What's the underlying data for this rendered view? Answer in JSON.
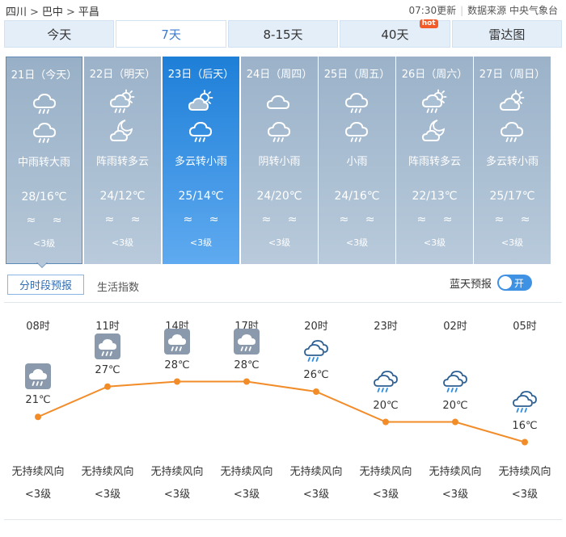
{
  "breadcrumb": {
    "province": "四川",
    "city": "巴中",
    "county": "平昌"
  },
  "meta": {
    "update": "07:30更新",
    "source_label": "数据来源 中央气象台"
  },
  "tabs": [
    {
      "label": "今天"
    },
    {
      "label": "7天"
    },
    {
      "label": "8-15天"
    },
    {
      "label": "40天",
      "badge": "hot"
    },
    {
      "label": "雷达图"
    }
  ],
  "days": [
    {
      "date": "21日（今天）",
      "icon_day": "rain-cloud-icon",
      "icon_night": "rain-cloud-icon",
      "desc": "中雨转大雨",
      "temp": "28/16℃",
      "wind": "≈ ≈",
      "level": "<3级"
    },
    {
      "date": "22日（明天）",
      "icon_day": "sun-shower-icon",
      "icon_night": "moon-cloud-icon",
      "desc": "阵雨转多云",
      "temp": "24/12℃",
      "wind": "≈ ≈",
      "level": "<3级"
    },
    {
      "date": "23日（后天）",
      "icon_day": "partly-cloudy-icon",
      "icon_night": "rain-cloud-icon",
      "desc": "多云转小雨",
      "temp": "25/14℃",
      "wind": "≈ ≈",
      "level": "<3级"
    },
    {
      "date": "24日（周四）",
      "icon_day": "cloud-icon",
      "icon_night": "rain-cloud-icon",
      "desc": "阴转小雨",
      "temp": "24/20℃",
      "wind": "≈ ≈",
      "level": "<3级"
    },
    {
      "date": "25日（周五）",
      "icon_day": "rain-cloud-icon",
      "icon_night": "rain-cloud-icon",
      "desc": "小雨",
      "temp": "24/16℃",
      "wind": "≈ ≈",
      "level": "<3级"
    },
    {
      "date": "26日（周六）",
      "icon_day": "sun-shower-icon",
      "icon_night": "moon-cloud-icon",
      "desc": "阵雨转多云",
      "temp": "22/13℃",
      "wind": "≈ ≈",
      "level": "<3级"
    },
    {
      "date": "27日（周日）",
      "icon_day": "partly-cloudy-icon",
      "icon_night": "rain-cloud-icon",
      "desc": "多云转小雨",
      "temp": "25/17℃",
      "wind": "≈ ≈",
      "level": "<3级"
    }
  ],
  "subtabs": {
    "hourly": "分时段预报",
    "life": "生活指数"
  },
  "bluesky": {
    "label": "蓝天预报",
    "toggle": "开"
  },
  "hourly": [
    {
      "time": "08时",
      "temp": "21℃",
      "icon": "rain-box-icon",
      "wind": "无持续风向",
      "level": "<3级"
    },
    {
      "time": "11时",
      "temp": "27℃",
      "icon": "rain-box-icon",
      "wind": "无持续风向",
      "level": "<3级"
    },
    {
      "time": "14时",
      "temp": "28℃",
      "icon": "rain-box-icon",
      "wind": "无持续风向",
      "level": "<3级"
    },
    {
      "time": "17时",
      "temp": "28℃",
      "icon": "rain-box-icon",
      "wind": "无持续风向",
      "level": "<3级"
    },
    {
      "time": "20时",
      "temp": "26℃",
      "icon": "light-rain-icon",
      "wind": "无持续风向",
      "level": "<3级"
    },
    {
      "time": "23时",
      "temp": "20℃",
      "icon": "light-rain-icon",
      "wind": "无持续风向",
      "level": "<3级"
    },
    {
      "time": "02时",
      "temp": "20℃",
      "icon": "light-rain-icon",
      "wind": "无持续风向",
      "level": "<3级"
    },
    {
      "time": "05时",
      "temp": "16℃",
      "icon": "light-rain-icon",
      "wind": "无持续风向",
      "level": "<3级"
    }
  ],
  "chart_data": {
    "type": "line",
    "x": [
      "08时",
      "11时",
      "14时",
      "17时",
      "20时",
      "23时",
      "02时",
      "05时"
    ],
    "series": [
      {
        "values": [
          21,
          27,
          28,
          28,
          26,
          20,
          20,
          16
        ]
      }
    ],
    "line_color": "#f28c28"
  }
}
